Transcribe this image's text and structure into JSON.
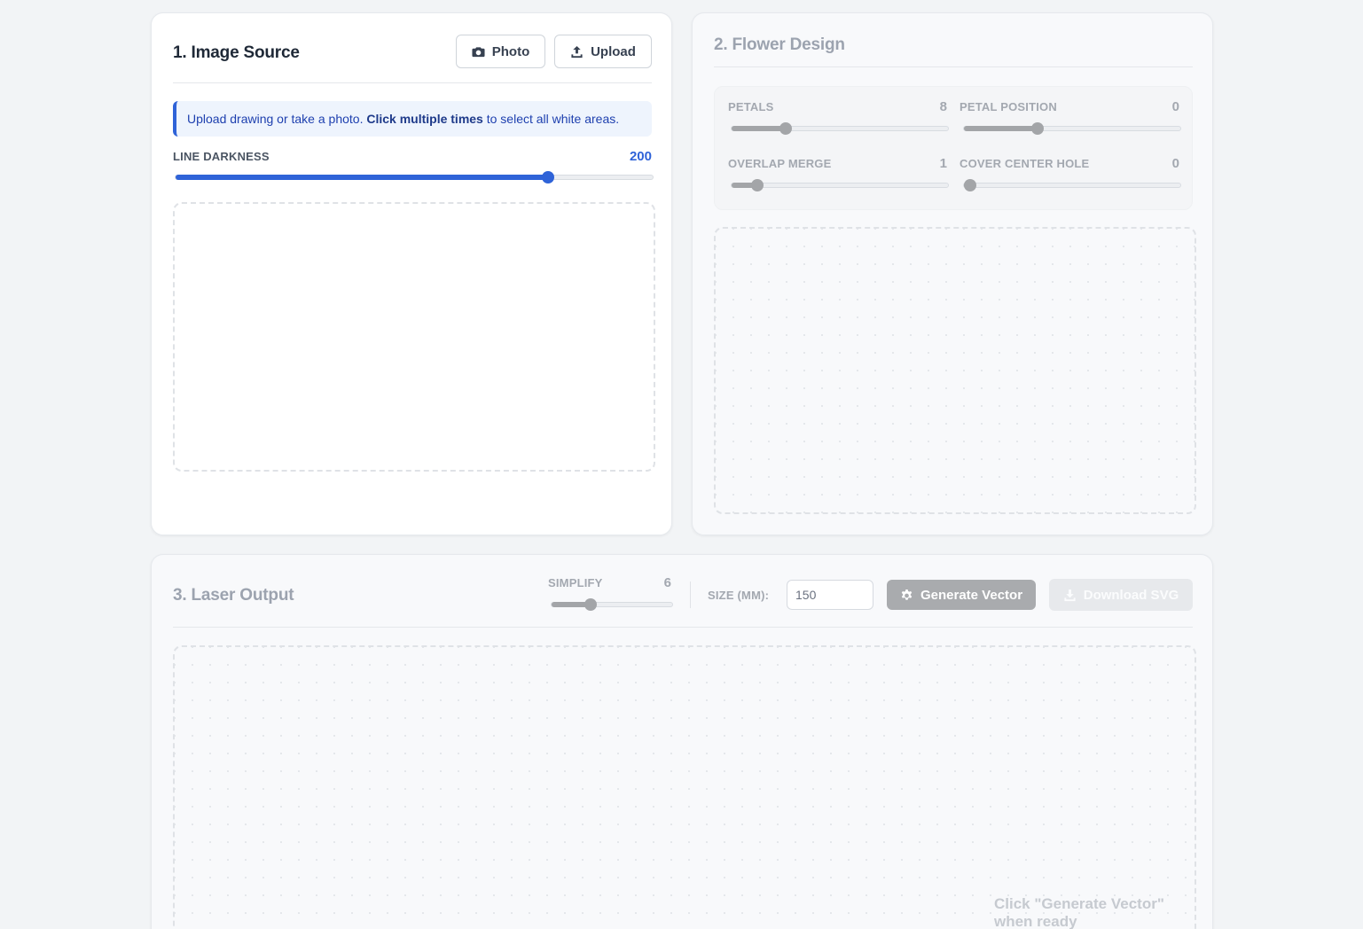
{
  "image_source": {
    "title": "1. Image Source",
    "photo_label": "Photo",
    "upload_label": "Upload",
    "info_prefix": "Upload drawing or take a photo. ",
    "info_bold": "Click multiple times",
    "info_suffix": " to select all white areas.",
    "line_darkness": {
      "label": "LINE DARKNESS",
      "value": "200",
      "fraction": 0.78
    },
    "accent_color": "#2f63d8"
  },
  "flower_design": {
    "title": "2. Flower Design",
    "petals": {
      "label": "PETALS",
      "value": "8",
      "fraction": 0.25
    },
    "petal_position": {
      "label": "PETAL POSITION",
      "value": "0",
      "fraction": 0.34
    },
    "overlap_merge": {
      "label": "OVERLAP MERGE",
      "value": "1",
      "fraction": 0.12
    },
    "cover_center_hole": {
      "label": "COVER CENTER HOLE",
      "value": "0",
      "fraction": 0.03
    }
  },
  "laser_output": {
    "title": "3. Laser Output",
    "simplify": {
      "label": "SIMPLIFY",
      "value": "6",
      "fraction": 0.32
    },
    "size_label": "SIZE (MM):",
    "size_value": "150",
    "generate_label": "Generate Vector",
    "download_label": "Download SVG",
    "hint": "Click \"Generate Vector\" when ready"
  },
  "icons": [
    "camera-icon",
    "upload-icon",
    "gear-icon",
    "download-icon"
  ]
}
